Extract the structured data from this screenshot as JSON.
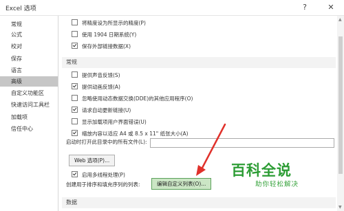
{
  "window": {
    "title": "Excel 选项",
    "help": "?",
    "close": "✕"
  },
  "sidebar": {
    "items": [
      {
        "label": "常规"
      },
      {
        "label": "公式"
      },
      {
        "label": "校对"
      },
      {
        "label": "保存"
      },
      {
        "label": "语言"
      },
      {
        "label": "高级",
        "active": true
      },
      {
        "label": "自定义功能区"
      },
      {
        "label": "快速访问工具栏"
      },
      {
        "label": "加载项"
      },
      {
        "label": "信任中心"
      }
    ]
  },
  "main": {
    "top_options": [
      {
        "label": "将精度设为所显示的精度(P)",
        "checked": false
      },
      {
        "label": "使用 1904 日期系统(Y)",
        "checked": false
      },
      {
        "label": "保存外部链接数据(X)",
        "checked": true
      }
    ],
    "general_section": "常规",
    "general_options": [
      {
        "label": "提供声音反馈(S)",
        "checked": false
      },
      {
        "label": "提供动画反馈(A)",
        "checked": true
      },
      {
        "label": "忽略使用动态数据交换(DDE)的其他应用程序(O)",
        "checked": false
      },
      {
        "label": "请求自动更新链接(U)",
        "checked": true
      },
      {
        "label": "显示加载项用户界面错误(U)",
        "checked": false
      },
      {
        "label": "缩放内容以适应 A4 或 8.5 x 11\" 纸张大小(A)",
        "checked": true
      }
    ],
    "startup_label": "启动时打开此目录中的所有文件(L):",
    "startup_value": "",
    "web_options_button": "Web 选项(P)...",
    "multithread": {
      "label": "启用多线程处理(P)",
      "checked": true
    },
    "custom_list_label": "创建用于排序和填充序列的列表:",
    "edit_custom_lists_button": "编辑自定义列表(O)...",
    "data_section": "数据"
  },
  "watermark": {
    "title": "百科全说",
    "subtitle": "助你轻松解决"
  },
  "colors": {
    "watermark": "#2c9c34",
    "arrow": "#e0312b",
    "highlight": "#cbe6c5"
  }
}
